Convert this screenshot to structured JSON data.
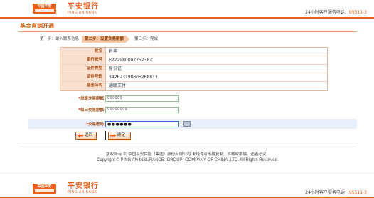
{
  "header": {
    "logo_text": "中国平安",
    "brand_cn": "平安银行",
    "brand_en": "PING AN BANK",
    "hotline_label": "24小时客户服务电话：",
    "hotline_number": "95511-3"
  },
  "page": {
    "title": "基金直销开通"
  },
  "steps": [
    {
      "label": "第一步：录入联系信息"
    },
    {
      "label": "第二步：设置交易限额"
    },
    {
      "label": "第三步：完成"
    }
  ],
  "info": [
    {
      "label": "姓名",
      "value": "肖坤"
    },
    {
      "label": "银行帐号",
      "value": "6222980007252382"
    },
    {
      "label": "证件类型",
      "value": "身份证"
    },
    {
      "label": "证件号码",
      "value": "342623198605268813"
    },
    {
      "label": "基金公司",
      "value": "通联支付"
    }
  ],
  "form": {
    "single_limit_label": "单笔交易限额",
    "single_limit_value": "999999",
    "daily_limit_label": "每日交易限额",
    "daily_limit_value": "99999999",
    "password_label": "交易密码",
    "password_value": "●●●●●●",
    "required_mark": "*"
  },
  "buttons": {
    "back": "返回",
    "confirm": "确定"
  },
  "footer": {
    "line1": "版权所有 © 中国平安保险（集团）股份有限公司 未经许可不得复制、转载或摘编，违者必究!",
    "line2": "Copyright © PING AN INSURANCE (GROUP) COMPANY OF CHINA ,LTD. All Rights Reserved"
  },
  "colors": {
    "accent": "#e8601c",
    "label_bg": "#f9e0cf",
    "active_step": "#f6c8a6"
  }
}
